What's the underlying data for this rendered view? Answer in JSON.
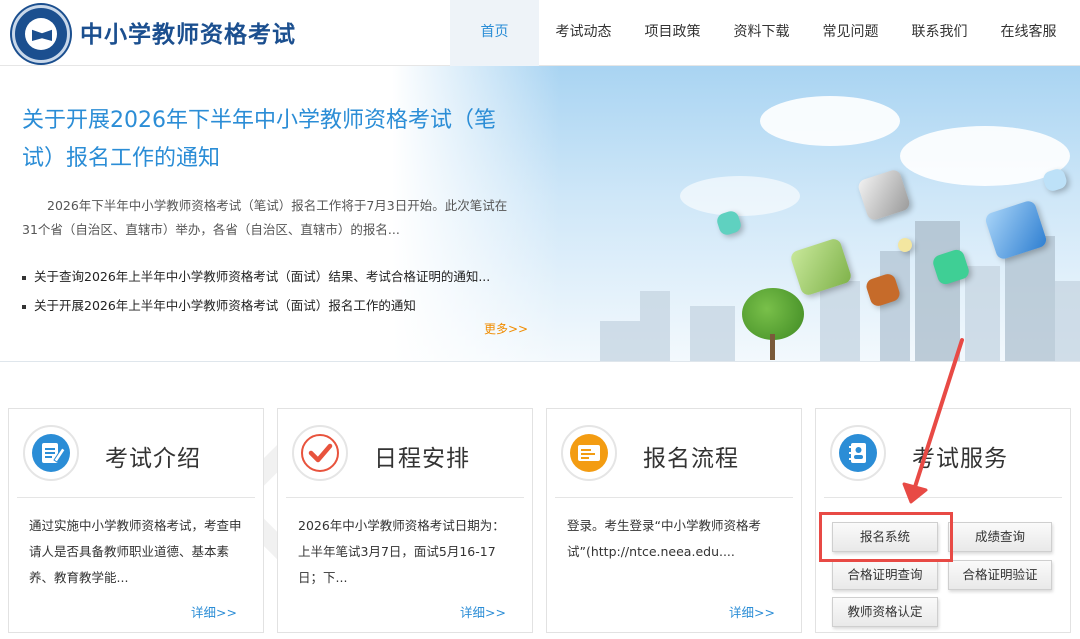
{
  "header": {
    "site_title": "中小学教师资格考试",
    "nav": [
      {
        "label": "首页",
        "active": true
      },
      {
        "label": "考试动态"
      },
      {
        "label": "项目政策"
      },
      {
        "label": "资料下载"
      },
      {
        "label": "常见问题"
      },
      {
        "label": "联系我们"
      },
      {
        "label": "在线客服"
      }
    ]
  },
  "banner": {
    "headline": "关于开展2026年下半年中小学教师资格考试（笔试）报名工作的通知",
    "summary": "2026年下半年中小学教师资格考试（笔试）报名工作将于7月3日开始。此次笔试在31个省（自治区、直辖市）举办，各省（自治区、直辖市）的报名...",
    "news": [
      "关于查询2026年上半年中小学教师资格考试（面试）结果、考试合格证明的通知...",
      "关于开展2026年上半年中小学教师资格考试（面试）报名工作的通知"
    ],
    "more": "更多>>"
  },
  "cards": [
    {
      "title": "考试介绍",
      "text": "通过实施中小学教师资格考试，考查申请人是否具备教师职业道德、基本素养、教育教学能...",
      "more": "详细>>",
      "icon": "document-edit-icon",
      "color": "#2b8dd6"
    },
    {
      "title": "日程安排",
      "text": "2026年中小学教师资格考试日期为：上半年笔试3月7日，面试5月16-17日；下...",
      "more": "详细>>",
      "icon": "checkmark-icon",
      "color": "#e8533d"
    },
    {
      "title": "报名流程",
      "text": "登录。考生登录“中小学教师资格考试”(http://ntce.neea.edu....",
      "more": "详细>>",
      "icon": "form-icon",
      "color": "#f39c12"
    },
    {
      "title": "考试服务",
      "icon": "contacts-book-icon",
      "color": "#2b8dd6"
    }
  ],
  "services": {
    "registration": "报名系统",
    "score_query": "成绩查询",
    "certificate_query": "合格证明查询",
    "certificate_verify": "合格证明验证",
    "teacher_certification": "教师资格认定"
  },
  "colors": {
    "brand": "#1b4f8f",
    "accent": "#2b8dd6",
    "more_link": "#f08c00",
    "highlight": "#e84a45"
  }
}
